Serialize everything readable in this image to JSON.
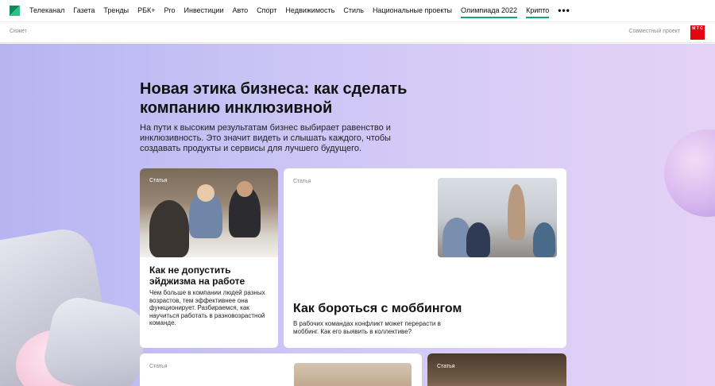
{
  "nav": {
    "items": [
      {
        "label": "Телеканал"
      },
      {
        "label": "Газета"
      },
      {
        "label": "Тренды"
      },
      {
        "label": "РБК+"
      },
      {
        "label": "Pro"
      },
      {
        "label": "Инвестиции"
      },
      {
        "label": "Авто"
      },
      {
        "label": "Спорт"
      },
      {
        "label": "Недвижимость"
      },
      {
        "label": "Стиль"
      },
      {
        "label": "Национальные проекты"
      },
      {
        "label": "Олимпиада 2022"
      },
      {
        "label": "Крипто"
      }
    ],
    "more": "•••"
  },
  "subbar": {
    "left": "Сюжет",
    "right": "Совместный проект",
    "partner_logo": "М Т С"
  },
  "hero": {
    "title": "Новая этика бизнеса: как сделать компанию инклюзивной",
    "description": "На пути к высоким результатам бизнес выбирает равенство и инклюзивность. Это значит видеть и слышать каждого, чтобы создавать продукты и сервисы для лучшего будущего."
  },
  "cards": [
    {
      "tag": "Статья",
      "title": "Как не допустить эйджизма на работе",
      "description": "Чем больше в компании людей разных возрастов, тем эффективнее она функционирует. Разбираемся, как научиться работать в разновозрастной команде."
    },
    {
      "tag": "Статья",
      "title": "Как бороться с моббингом",
      "description": "В рабочих командах конфликт может перерасти в моббинг. Как его выявить в коллективе?"
    },
    {
      "tag": "Статья"
    },
    {
      "tag": "Статья"
    }
  ],
  "colors": {
    "accent_underline": "#1aa36a",
    "logo_green": "#0c8a5b",
    "mts_red": "#e30611"
  }
}
